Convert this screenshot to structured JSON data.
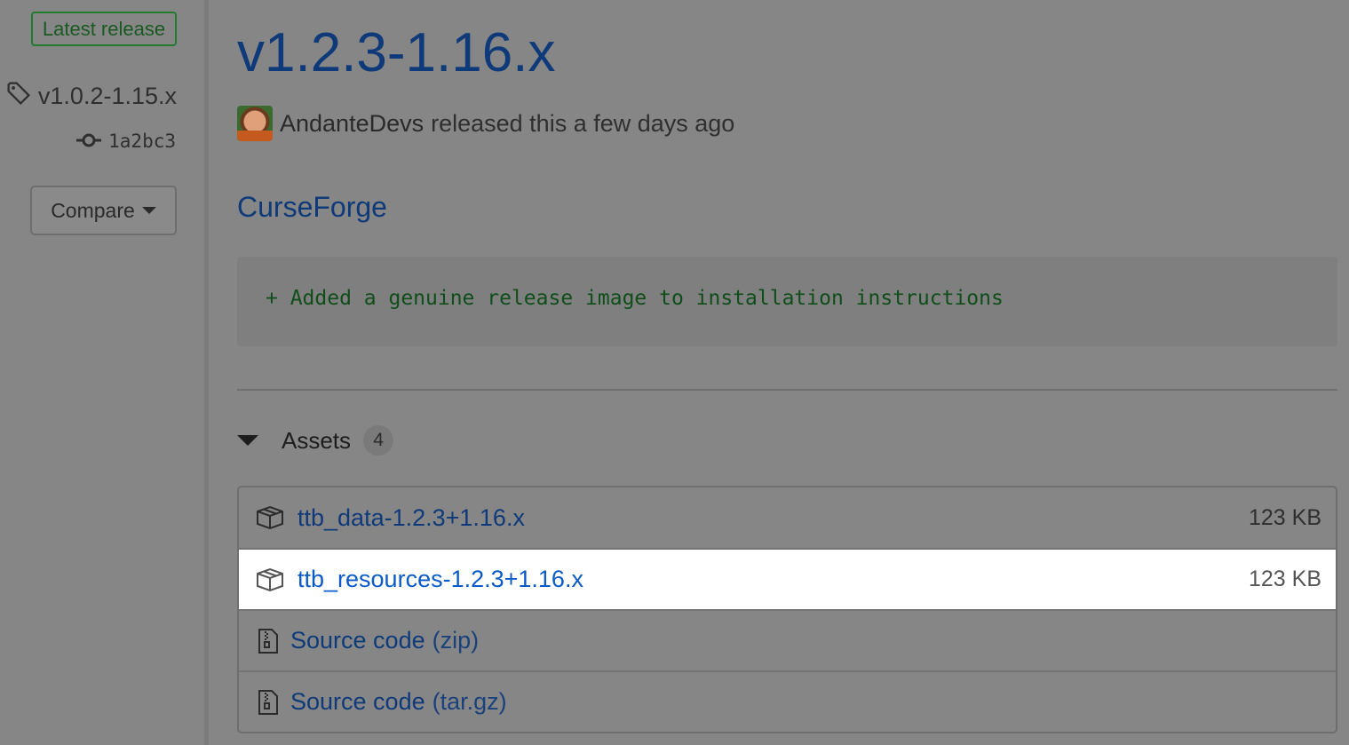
{
  "sidebar": {
    "latest_badge": "Latest release",
    "tag": "v1.0.2-1.15.x",
    "commit": "1a2bc3",
    "compare_label": "Compare"
  },
  "release": {
    "title": "v1.2.3-1.16.x",
    "author": "AndanteDevs",
    "released_text": "released this a few days ago",
    "section_heading": "CurseForge",
    "code_line": "+ Added a genuine release image to installation instructions"
  },
  "assets": {
    "label": "Assets",
    "count": "4",
    "items": [
      {
        "name": "ttb_data-1.2.3+1.16.x",
        "size": "123 KB",
        "icon": "package-icon"
      },
      {
        "name": "ttb_resources-1.2.3+1.16.x",
        "size": "123 KB",
        "icon": "package-icon"
      },
      {
        "name": "Source code",
        "suffix": "(zip)",
        "icon": "file-zip-icon"
      },
      {
        "name": "Source code",
        "suffix": "(tar.gz)",
        "icon": "file-zip-icon"
      }
    ]
  }
}
